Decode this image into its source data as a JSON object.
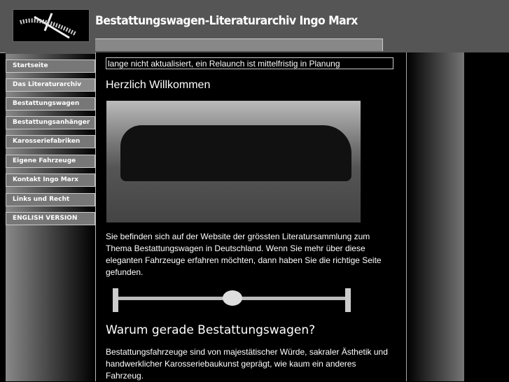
{
  "header": {
    "title": "Bestattungswagen-Literaturarchiv Ingo Marx",
    "logo": "cross-palm-logo"
  },
  "nav": [
    {
      "label": "Startseite"
    },
    {
      "label": "Das Literaturarchiv"
    },
    {
      "label": "Bestattungswagen"
    },
    {
      "label": "Bestattungsanhänger"
    },
    {
      "label": "Karosseriefabriken"
    },
    {
      "label": "Eigene Fahrzeuge"
    },
    {
      "label": "Kontakt Ingo Marx"
    },
    {
      "label": "Links und Recht"
    },
    {
      "label": "ENGLISH VERSION"
    }
  ],
  "main": {
    "notice": "lange nicht aktualisiert, ein Relaunch ist mittelfristig in Planung",
    "heading": "Herzlich Willkommen",
    "intro": "Sie befinden sich auf der Website der grössten Literatursammlung zum Thema Bestattungswagen in Deutschland. Wenn Sie mehr über diese eleganten Fahrzeuge erfahren möchten, dann haben Sie die richtige Seite gefunden.",
    "heading2": "Warum gerade Bestattungswagen?",
    "para2": "Bestattungsfahrzeuge sind von majestätischer Würde, sakraler Ästhetik und handwerklicher Karosseriebaukunst geprägt, wie kaum ein anderes Fahrzeug."
  }
}
